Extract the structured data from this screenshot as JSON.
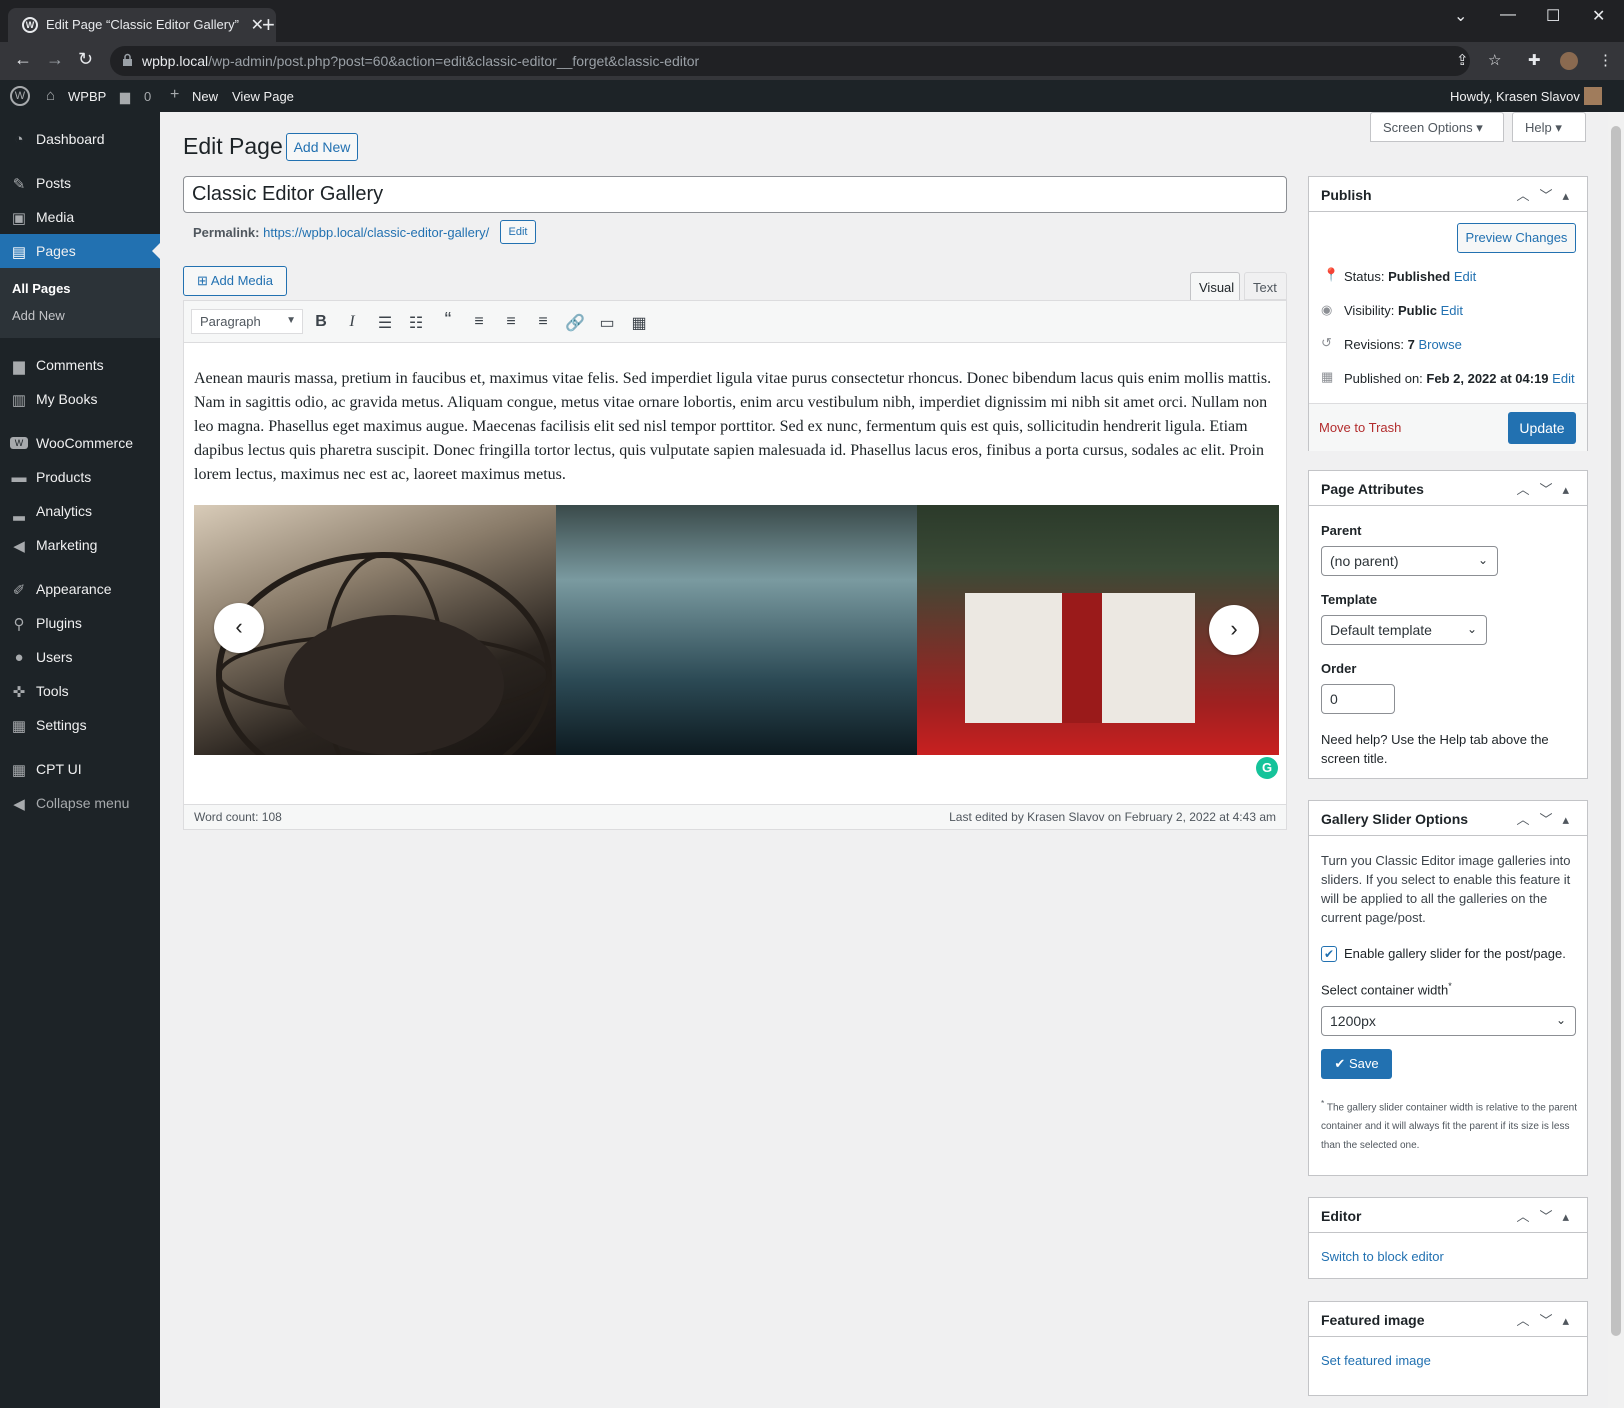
{
  "browser": {
    "tab_title": "Edit Page “Classic Editor Gallery”",
    "url_domain": "wpbp.local",
    "url_path": "/wp-admin/post.php?post=60&action=edit&classic-editor__forget&classic-editor"
  },
  "adminbar": {
    "site": "WPBP",
    "comments": "0",
    "new": "New",
    "view": "View Page",
    "howdy": "Howdy, Krasen Slavov"
  },
  "sidebar": {
    "items": [
      {
        "label": "Dashboard",
        "icon": "dashboard-icon"
      },
      {
        "label": "Posts",
        "icon": "pin-icon"
      },
      {
        "label": "Media",
        "icon": "media-icon"
      },
      {
        "label": "Pages",
        "icon": "page-icon"
      },
      {
        "label": "Comments",
        "icon": "comment-icon"
      },
      {
        "label": "My Books",
        "icon": "book-icon"
      },
      {
        "label": "WooCommerce",
        "icon": "woo-icon"
      },
      {
        "label": "Products",
        "icon": "archive-icon"
      },
      {
        "label": "Analytics",
        "icon": "chart-icon"
      },
      {
        "label": "Marketing",
        "icon": "megaphone-icon"
      },
      {
        "label": "Appearance",
        "icon": "brush-icon"
      },
      {
        "label": "Plugins",
        "icon": "plugin-icon"
      },
      {
        "label": "Users",
        "icon": "user-icon"
      },
      {
        "label": "Tools",
        "icon": "wrench-icon"
      },
      {
        "label": "Settings",
        "icon": "settings-icon"
      },
      {
        "label": "CPT UI",
        "icon": "grid-icon"
      },
      {
        "label": "Collapse menu",
        "icon": "collapse-icon"
      }
    ],
    "sub_all_pages": "All Pages",
    "sub_add_new": "Add New"
  },
  "header": {
    "screen_options": "Screen Options",
    "help": "Help",
    "title": "Edit Page",
    "add_new": "Add New"
  },
  "post": {
    "title_value": "Classic Editor Gallery",
    "permalink_label": "Permalink:",
    "permalink_url": "https://wpbp.local/classic-editor-gallery/",
    "permalink_edit": "Edit"
  },
  "editor": {
    "add_media": "Add Media",
    "tab_visual": "Visual",
    "tab_text": "Text",
    "format": "Paragraph",
    "content": "Aenean mauris massa, pretium in faucibus et, maximus vitae felis. Sed imperdiet ligula vitae purus consectetur rhoncus. Donec bibendum lacus quis enim mollis mattis. Nam in sagittis odio, ac gravida metus. Aliquam congue, metus vitae ornare lobortis, enim arcu vestibulum nibh, imperdiet dignissim mi nibh sit amet orci. Nullam non leo magna. Phasellus eget maximus augue. Maecenas facilisis elit sed nisl tempor porttitor. Sed ex nunc, fermentum quis est quis, sollicitudin hendrerit ligula. Etiam dapibus lectus quis pharetra suscipit. Donec fringilla tortor lectus, quis vulputate sapien malesuada id. Phasellus lacus eros, finibus a porta cursus, sodales ac elit. Proin lorem lectus, maximus nec est ac, laoreet maximus metus.",
    "word_count": "Word count: 108",
    "last_edited": "Last edited by Krasen Slavov on February 2, 2022 at 4:43 am"
  },
  "publish": {
    "title": "Publish",
    "preview": "Preview Changes",
    "status_label": "Status:",
    "status_value": "Published",
    "visibility_label": "Visibility:",
    "visibility_value": "Public",
    "revisions_label": "Revisions:",
    "revisions_value": "7",
    "browse": "Browse",
    "published_label": "Published on:",
    "published_value": "Feb 2, 2022 at 04:19",
    "edit": "Edit",
    "trash": "Move to Trash",
    "update": "Update"
  },
  "attributes": {
    "title": "Page Attributes",
    "parent_label": "Parent",
    "parent_value": "(no parent)",
    "template_label": "Template",
    "template_value": "Default template",
    "order_label": "Order",
    "order_value": "0",
    "help": "Need help? Use the Help tab above the screen title."
  },
  "gallery_slider": {
    "title": "Gallery Slider Options",
    "desc": "Turn you Classic Editor image galleries into sliders. If you select to enable this feature it will be applied to all the galleries on the current page/post.",
    "checkbox_label": "Enable gallery slider for the post/page.",
    "width_label": "Select container width",
    "width_value": "1200px",
    "save": "Save",
    "note": "The gallery slider container width is relative to the parent container and it will always fit the parent if its size is less than the selected one."
  },
  "editor_box": {
    "title": "Editor",
    "link": "Switch to block editor"
  },
  "featured": {
    "title": "Featured image",
    "link": "Set featured image"
  },
  "colors": {
    "accent": "#2271b1",
    "sidebar_bg": "#1d2327",
    "page_bg": "#f0f0f1"
  }
}
